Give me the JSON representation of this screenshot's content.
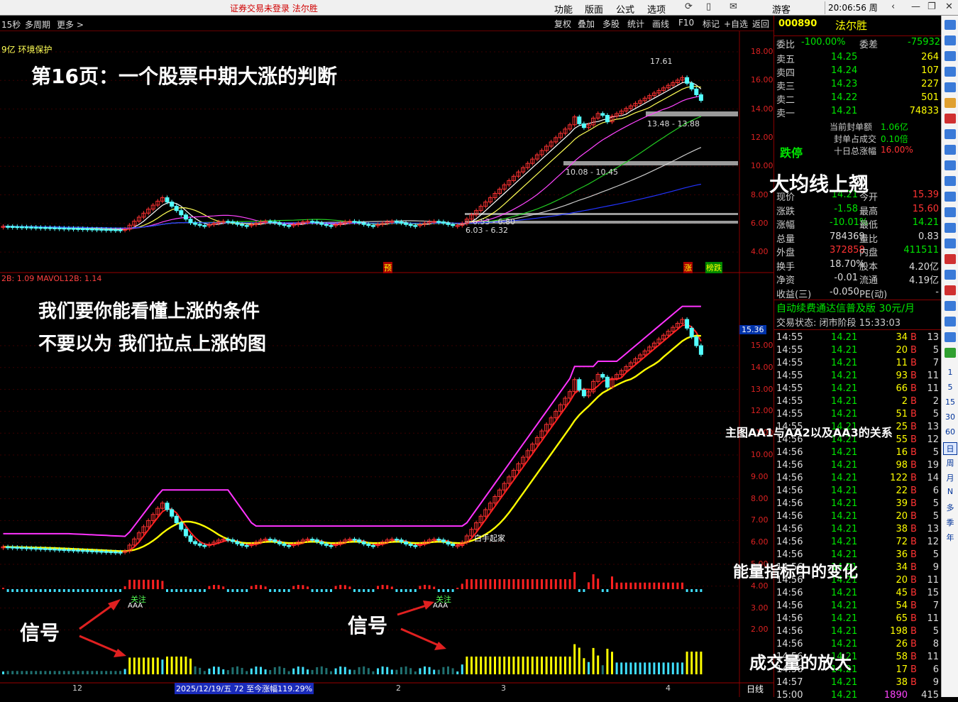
{
  "top_bar": {
    "warning": "证券交易未登录  法尔胜",
    "menus": [
      "功能",
      "版面",
      "公式",
      "选项"
    ],
    "user": "游客",
    "time": "20:06:56 周日"
  },
  "sub_bar": {
    "left_items": [
      "15秒",
      "多周期",
      "更多 >"
    ],
    "buttons": [
      "复权",
      "叠加",
      "多股",
      "统计",
      "画线",
      "F10",
      "标记",
      "+自选",
      "返回"
    ]
  },
  "chart": {
    "tag_left": "9亿 环境保护",
    "upper_title": "第16页：一个股票中期大涨的判断",
    "price_marks": {
      "high": "17.61",
      "zone1": "13.48 - 13.88",
      "zone2": "10.08 - 10.45",
      "zone3": "6.53 - 6.80",
      "zone4": "6.03 - 6.32"
    },
    "upper_axis": [
      "18.00",
      "16.00",
      "14.00",
      "12.00",
      "10.00",
      "8.00",
      "6.00",
      "4.00"
    ],
    "upper_tags": {
      "yu": "预",
      "zhang": "涨",
      "bang": "榜跌"
    },
    "lower_indicator_label": "2B: 1.09  MAVOL12B: 1.14",
    "lower_axis": [
      "15.00",
      "14.00",
      "13.00",
      "12.00",
      "11.00",
      "10.00",
      "9.00",
      "8.00",
      "7.00",
      "6.00",
      "5.00",
      "4.00",
      "3.00",
      "2.00"
    ],
    "lower_price_box": "15.36",
    "lower_text1": "我们要你能看懂上涨的条件",
    "lower_text2": "不要以为  我们拉点上涨的图",
    "annot_aa": "主图AA1与AA2以及AA3的关系",
    "annot_energy": "能量指标中的变化",
    "annot_volume": "成交量的放大",
    "annot_big_ma": "大均线上翘",
    "signal": "信号",
    "signal_note1": "关注",
    "signal_note2": "AAA",
    "white_hand": "白手起家",
    "date_axis": [
      "12",
      "2",
      "3",
      "4"
    ],
    "date_label": "2025/12/19/五 72 至今涨幅119.29%",
    "period": "日线"
  },
  "right_panel": {
    "code": "000890",
    "name": "法尔胜",
    "weibi_label": "委比",
    "weibi": "-100.00%",
    "weicha_label": "委差",
    "weicha": "-75932",
    "asks": [
      {
        "label": "卖五",
        "price": "14.25",
        "vol": "264"
      },
      {
        "label": "卖四",
        "price": "14.24",
        "vol": "107"
      },
      {
        "label": "卖三",
        "price": "14.23",
        "vol": "227"
      },
      {
        "label": "卖二",
        "price": "14.22",
        "vol": "501"
      },
      {
        "label": "卖一",
        "price": "14.21",
        "vol": "74833"
      }
    ],
    "fengdan_label": "当前封单额",
    "fengdan": "1.06亿",
    "fengzhan_label": "封单占成交",
    "fengzhan": "0.10倍",
    "shiri_label": "十日总涨幅",
    "shiri": "16.00%",
    "dieting": "跌停",
    "stats": [
      {
        "l1": "现价",
        "v1": "14.21",
        "l2": "今开",
        "v2": "15.39"
      },
      {
        "l1": "涨跌",
        "v1": "-1.58",
        "l2": "最高",
        "v2": "15.60"
      },
      {
        "l1": "涨幅",
        "v1": "-10.01%",
        "l2": "最低",
        "v2": "14.21"
      },
      {
        "l1": "总量",
        "v1": "784369",
        "l2": "量比",
        "v2": "0.83"
      },
      {
        "l1": "外盘",
        "v1": "372858",
        "l2": "内盘",
        "v2": "411511"
      },
      {
        "l1": "换手",
        "v1": "18.70%",
        "l2": "股本",
        "v2": "4.20亿"
      },
      {
        "l1": "净资",
        "v1": "-0.01",
        "l2": "流通",
        "v2": "4.19亿"
      },
      {
        "l1": "收益(三)",
        "v1": "-0.050",
        "l2": "PE(动)",
        "v2": "-"
      }
    ],
    "ad": "自动续费通达信普及版  30元/月",
    "trade_state": "交易状态: 闭市阶段 15:33:03",
    "ticks": [
      {
        "t": "14:55",
        "p": "14.21",
        "v": "34",
        "s": "B",
        "n": "13"
      },
      {
        "t": "14:55",
        "p": "14.21",
        "v": "20",
        "s": "B",
        "n": "5"
      },
      {
        "t": "14:55",
        "p": "14.21",
        "v": "11",
        "s": "B",
        "n": "7"
      },
      {
        "t": "14:55",
        "p": "14.21",
        "v": "93",
        "s": "B",
        "n": "11"
      },
      {
        "t": "14:55",
        "p": "14.21",
        "v": "66",
        "s": "B",
        "n": "11"
      },
      {
        "t": "14:55",
        "p": "14.21",
        "v": "2",
        "s": "B",
        "n": "2"
      },
      {
        "t": "14:55",
        "p": "14.21",
        "v": "51",
        "s": "B",
        "n": "5"
      },
      {
        "t": "14:55",
        "p": "14.21",
        "v": "25",
        "s": "B",
        "n": "13"
      },
      {
        "t": "14:56",
        "p": "14.21",
        "v": "55",
        "s": "B",
        "n": "12"
      },
      {
        "t": "14:56",
        "p": "14.21",
        "v": "16",
        "s": "B",
        "n": "5"
      },
      {
        "t": "14:56",
        "p": "14.21",
        "v": "98",
        "s": "B",
        "n": "19"
      },
      {
        "t": "14:56",
        "p": "14.21",
        "v": "122",
        "s": "B",
        "n": "14"
      },
      {
        "t": "14:56",
        "p": "14.21",
        "v": "22",
        "s": "B",
        "n": "6"
      },
      {
        "t": "14:56",
        "p": "14.21",
        "v": "39",
        "s": "B",
        "n": "5"
      },
      {
        "t": "14:56",
        "p": "14.21",
        "v": "20",
        "s": "B",
        "n": "5"
      },
      {
        "t": "14:56",
        "p": "14.21",
        "v": "38",
        "s": "B",
        "n": "13"
      },
      {
        "t": "14:56",
        "p": "14.21",
        "v": "72",
        "s": "B",
        "n": "12"
      },
      {
        "t": "14:56",
        "p": "14.21",
        "v": "36",
        "s": "B",
        "n": "5"
      },
      {
        "t": "14:56",
        "p": "14.21",
        "v": "34",
        "s": "B",
        "n": "9"
      },
      {
        "t": "14:56",
        "p": "14.21",
        "v": "20",
        "s": "B",
        "n": "11"
      },
      {
        "t": "14:56",
        "p": "14.21",
        "v": "45",
        "s": "B",
        "n": "15"
      },
      {
        "t": "14:56",
        "p": "14.21",
        "v": "54",
        "s": "B",
        "n": "7"
      },
      {
        "t": "14:56",
        "p": "14.21",
        "v": "65",
        "s": "B",
        "n": "11"
      },
      {
        "t": "14:56",
        "p": "14.21",
        "v": "198",
        "s": "B",
        "n": "5"
      },
      {
        "t": "14:56",
        "p": "14.21",
        "v": "26",
        "s": "B",
        "n": "8"
      },
      {
        "t": "14:56",
        "p": "14.21",
        "v": "58",
        "s": "B",
        "n": "11"
      },
      {
        "t": "14:56",
        "p": "14.21",
        "v": "17",
        "s": "B",
        "n": "6"
      },
      {
        "t": "14:57",
        "p": "14.21",
        "v": "38",
        "s": "B",
        "n": "9"
      },
      {
        "t": "15:00",
        "p": "14.21",
        "v": "1890",
        "s": "",
        "n": "415"
      }
    ]
  },
  "side_strip": [
    "1",
    "5",
    "15",
    "30",
    "60",
    "日",
    "周",
    "月",
    "N",
    "多",
    "季",
    "年"
  ],
  "colors": {
    "up": "#ff3232",
    "down": "#54ffff",
    "price_green": "#00e600",
    "yellow": "#ffff00",
    "magenta": "#ff33ff"
  }
}
